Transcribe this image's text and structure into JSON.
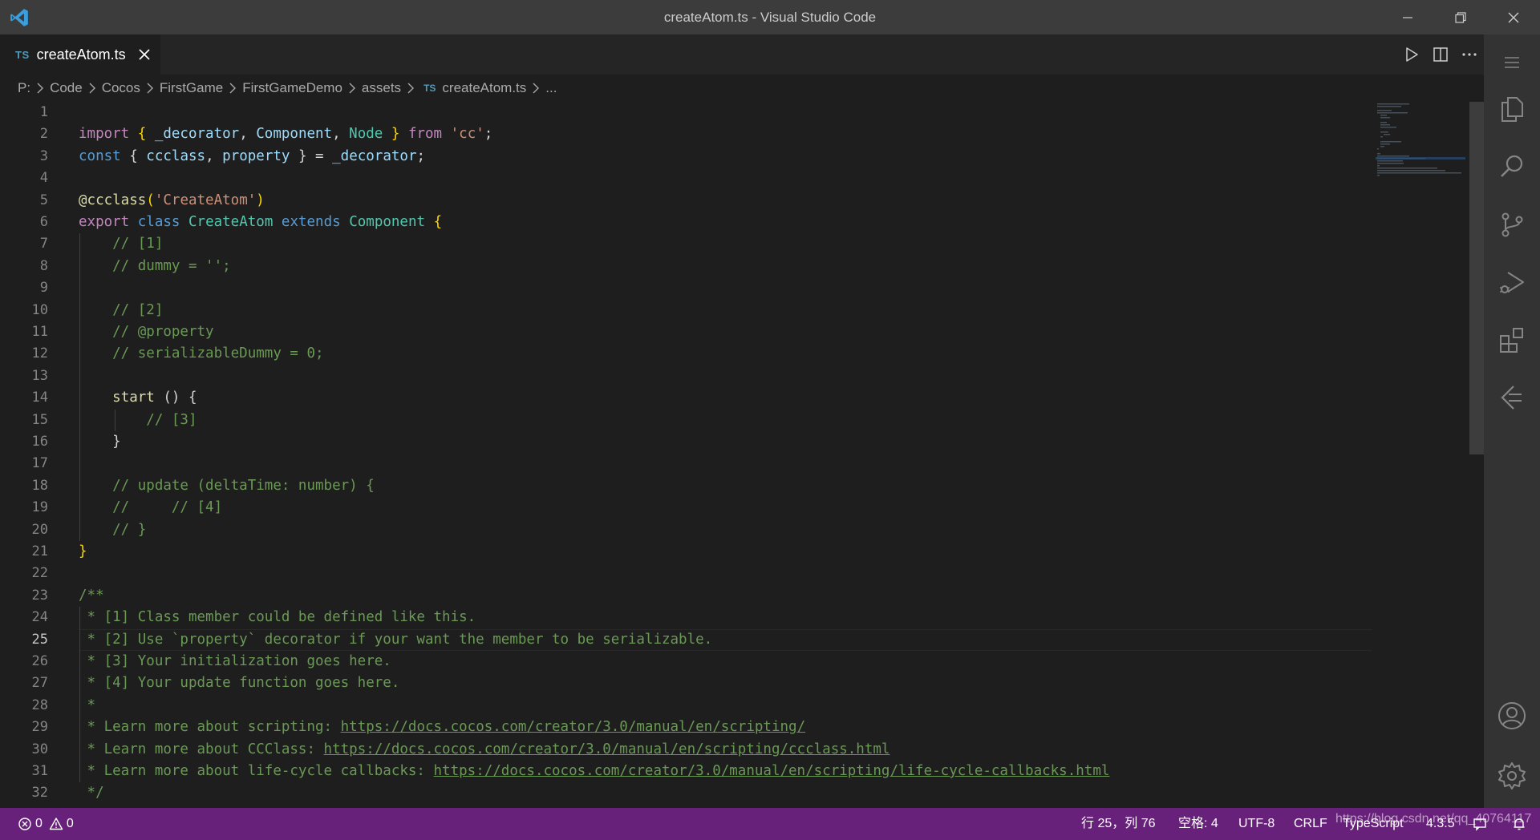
{
  "window": {
    "title": "createAtom.ts - Visual Studio Code"
  },
  "tab": {
    "lang_badge": "TS",
    "label": "createAtom.ts"
  },
  "breadcrumb": {
    "items": [
      "P:",
      "Code",
      "Cocos",
      "FirstGame",
      "FirstGameDemo",
      "assets"
    ],
    "file_badge": "TS",
    "file": "createAtom.ts",
    "more": "..."
  },
  "editor": {
    "active_line": 25,
    "line_numbers": [
      "1",
      "2",
      "3",
      "4",
      "5",
      "6",
      "7",
      "8",
      "9",
      "10",
      "11",
      "12",
      "13",
      "14",
      "15",
      "16",
      "17",
      "18",
      "19",
      "20",
      "21",
      "22",
      "23",
      "24",
      "25",
      "26",
      "27",
      "28",
      "29",
      "30",
      "31",
      "32"
    ],
    "code": {
      "l2": [
        "import",
        " { ",
        "_decorator",
        ", ",
        "Component",
        ", ",
        "Node",
        " } ",
        "from",
        " ",
        "'cc'",
        ";"
      ],
      "l3": [
        "const",
        " { ",
        "ccclass",
        ", ",
        "property",
        " } = ",
        "_decorator",
        ";"
      ],
      "l5": [
        "@ccclass",
        "(",
        "'CreateAtom'",
        ")"
      ],
      "l6": [
        "export",
        " ",
        "class",
        " ",
        "CreateAtom",
        " ",
        "extends",
        " ",
        "Component",
        " ",
        "{"
      ],
      "l7": "    // [1]",
      "l8": "    // dummy = '';",
      "l10": "    // [2]",
      "l11": "    // @property",
      "l12": "    // serializableDummy = 0;",
      "l14": [
        "    ",
        "start",
        " () {"
      ],
      "l15": "        // [3]",
      "l16": "    }",
      "l18": "    // update (deltaTime: number) {",
      "l19": "    //     // [4]",
      "l20": "    // }",
      "l21": "}",
      "l23": "/**",
      "l24": " * [1] Class member could be defined like this.",
      "l25": " * [2] Use `property` decorator if your want the member to be serializable.",
      "l26": " * [3] Your initialization goes here.",
      "l27": " * [4] Your update function goes here.",
      "l28": " *",
      "l29": [
        " * Learn more about scripting: ",
        "https://docs.cocos.com/creator/3.0/manual/en/scripting/"
      ],
      "l30": [
        " * Learn more about CCClass: ",
        "https://docs.cocos.com/creator/3.0/manual/en/scripting/ccclass.html"
      ],
      "l31": [
        " * Learn more about life-cycle callbacks: ",
        "https://docs.cocos.com/creator/3.0/manual/en/scripting/life-cycle-callbacks.html"
      ],
      "l32": " */"
    }
  },
  "statusbar": {
    "errors": "0",
    "warnings": "0",
    "position": "行 25，列 76",
    "spaces": "空格: 4",
    "encoding": "UTF-8",
    "eol": "CRLF",
    "language": "TypeScript",
    "version": "4.3.5",
    "watermark": "https://blog.csdn.net/qq_40764117"
  },
  "colors": {
    "titlebar": "#3c3c3c",
    "editor_bg": "#1e1e1e",
    "activitybar": "#333333",
    "statusbar": "#68217a",
    "keyword": "#569cd6",
    "control_keyword": "#c586c0",
    "variable": "#9cdcfe",
    "class": "#4ec9b0",
    "function": "#dcdcaa",
    "string": "#ce9178",
    "comment": "#6a9955"
  },
  "icons": {
    "activity": [
      "files-icon",
      "search-icon",
      "source-control-icon",
      "run-debug-icon",
      "extensions-icon",
      "remote-explorer-icon",
      "account-icon",
      "settings-gear-icon"
    ],
    "editor_actions": [
      "run-icon",
      "split-editor-icon",
      "more-actions-icon"
    ]
  }
}
